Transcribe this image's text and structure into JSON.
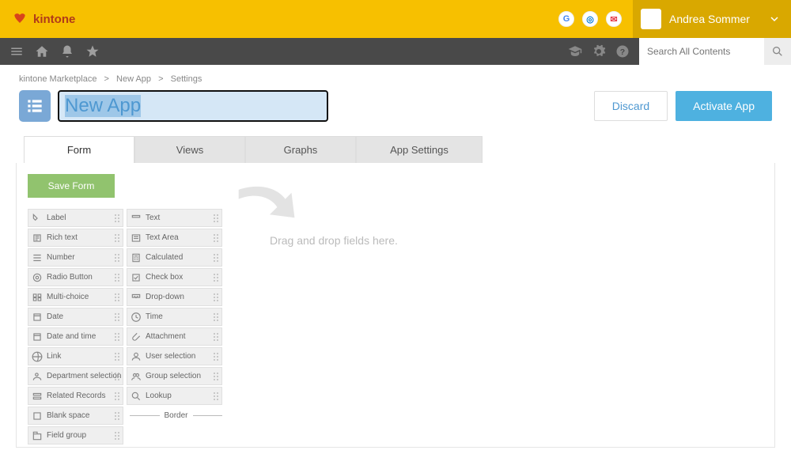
{
  "brand": {
    "name": "kintone"
  },
  "user": {
    "name": "Andrea Sommer"
  },
  "search": {
    "placeholder": "Search All Contents"
  },
  "breadcrumb": {
    "items": [
      "kintone Marketplace",
      "New App",
      "Settings"
    ],
    "sep": ">"
  },
  "title": {
    "value": "New App",
    "discard": "Discard",
    "activate": "Activate App"
  },
  "tabs": {
    "form": "Form",
    "views": "Views",
    "graphs": "Graphs",
    "settings": "App Settings"
  },
  "palette": {
    "save": "Save Form",
    "items_left": [
      "Label",
      "Rich text",
      "Number",
      "Radio Button",
      "Multi-choice",
      "Date",
      "Date and time",
      "Link",
      "Department selection",
      "Related Records",
      "Blank space",
      "Field group"
    ],
    "items_right": [
      "Text",
      "Text Area",
      "Calculated",
      "Check box",
      "Drop-down",
      "Time",
      "Attachment",
      "User selection",
      "Group selection",
      "Lookup",
      "Border"
    ]
  },
  "canvas": {
    "placeholder": "Drag and drop fields here."
  }
}
